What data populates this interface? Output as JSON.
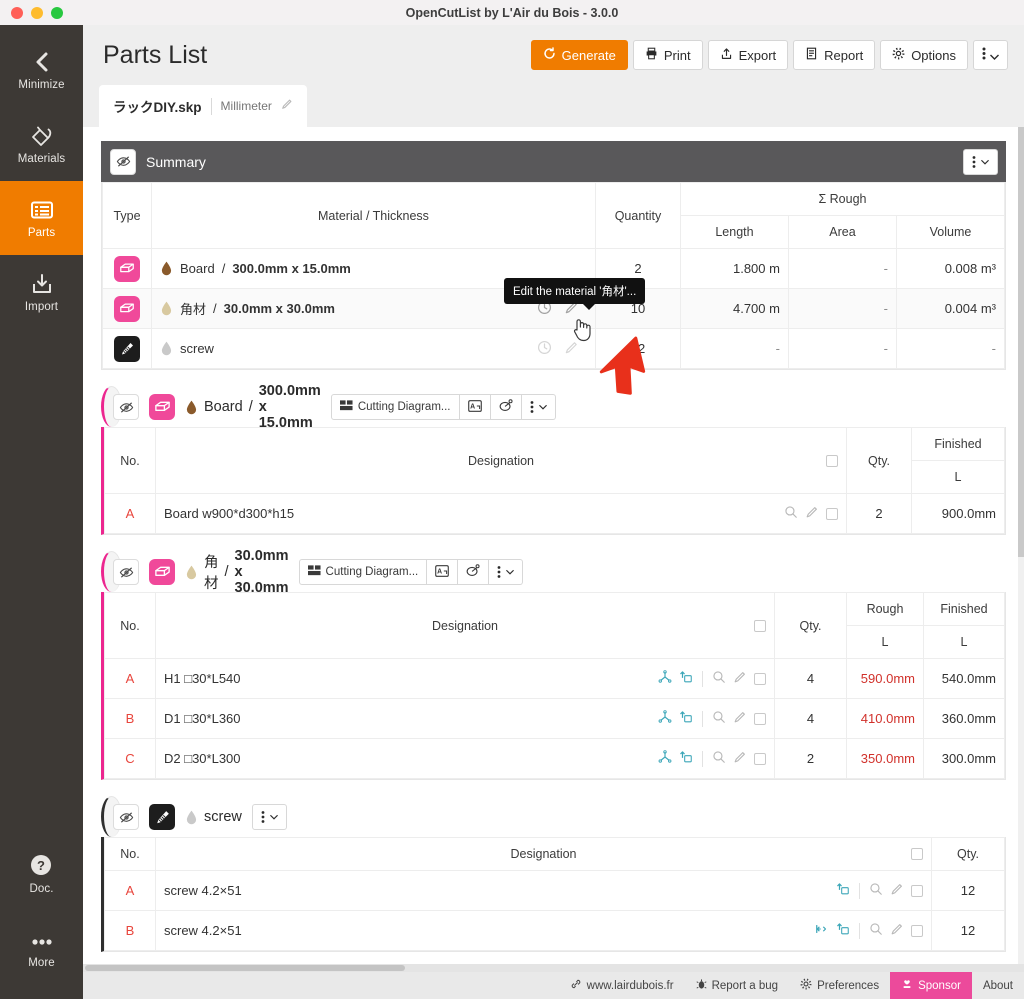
{
  "window": {
    "title": "OpenCutList by L'Air du Bois - 3.0.0"
  },
  "sidebar": {
    "items": [
      {
        "label": "Minimize",
        "icon": "chevron-left-icon",
        "active": false
      },
      {
        "label": "Materials",
        "icon": "materials-paint-icon",
        "active": false
      },
      {
        "label": "Parts",
        "icon": "parts-list-icon",
        "active": true
      },
      {
        "label": "Import",
        "icon": "import-download-icon",
        "active": false
      }
    ],
    "bottom": [
      {
        "label": "Doc.",
        "icon": "question-circle-icon"
      },
      {
        "label": "More",
        "icon": "ellipsis-icon"
      }
    ]
  },
  "header": {
    "title": "Parts List",
    "buttons": [
      {
        "label": "Generate",
        "icon": "refresh-icon",
        "primary": true
      },
      {
        "label": "Print",
        "icon": "printer-icon",
        "primary": false
      },
      {
        "label": "Export",
        "icon": "export-upload-icon",
        "primary": false
      },
      {
        "label": "Report",
        "icon": "report-icon",
        "primary": false
      },
      {
        "label": "Options",
        "icon": "gear-icon",
        "primary": false
      }
    ],
    "kebab_label": "⋮"
  },
  "tab": {
    "name": "ラックDIY.skp",
    "unit": "Millimeter",
    "edit_icon": "pencil-icon"
  },
  "tooltip": {
    "text": "Edit the material '角材'..."
  },
  "summary": {
    "title": "Summary",
    "headers": {
      "type": "Type",
      "material": "Material / Thickness",
      "quantity": "Quantity",
      "group": "Σ Rough",
      "length": "Length",
      "area": "Area",
      "volume": "Volume"
    },
    "rows": [
      {
        "type_icon": "board-solid-icon",
        "name": "Board",
        "spec": "300.0mm x 15.0mm",
        "quantity": "2",
        "length": "1.800 m",
        "area": "-",
        "volume": "0.008 m³",
        "dot": "#8a5a2b"
      },
      {
        "type_icon": "board-solid-icon",
        "name": "角材",
        "spec": "30.0mm x 30.0mm",
        "quantity": "10",
        "length": "4.700 m",
        "area": "-",
        "volume": "0.004 m³",
        "dot": "#d8c9a0"
      },
      {
        "type_icon": "screw-icon",
        "name": "screw",
        "spec": "",
        "quantity": "32",
        "length": "-",
        "area": "-",
        "volume": "-",
        "dot": "#c9c9c9"
      }
    ]
  },
  "sections": [
    {
      "id": "board",
      "accent": "pink",
      "badge_icon": "board-solid-icon",
      "badge_style": "pink",
      "dot": "#8a5a2b",
      "name": "Board",
      "spec": "300.0mm x 15.0mm",
      "actions": [
        {
          "label": "Cutting Diagram...",
          "icon": "cutting-diagram-icon"
        },
        {
          "label": "",
          "icon": "labels-icon"
        },
        {
          "label": "",
          "icon": "layout-3d-icon"
        },
        {
          "label": "⋮",
          "icon": "kebab-icon"
        }
      ],
      "headers": {
        "no": "No.",
        "designation": "Designation",
        "qty": "Qty.",
        "rough": "",
        "finished": "Finished",
        "rough_sub": "",
        "finished_sub": "L"
      },
      "has_rough": false,
      "rows": [
        {
          "no": "A",
          "designation": "Board w900*d300*h15",
          "qty": "2",
          "rough": "",
          "finished": "900.0mm",
          "icons": []
        }
      ]
    },
    {
      "id": "kakuzai",
      "accent": "pink",
      "badge_icon": "board-solid-icon",
      "badge_style": "pink",
      "dot": "#d8c9a0",
      "name": "角材",
      "spec": "30.0mm x 30.0mm",
      "actions": [
        {
          "label": "Cutting Diagram...",
          "icon": "cutting-diagram-icon"
        },
        {
          "label": "",
          "icon": "labels-icon"
        },
        {
          "label": "",
          "icon": "layout-3d-icon"
        },
        {
          "label": "⋮",
          "icon": "kebab-icon"
        }
      ],
      "headers": {
        "no": "No.",
        "designation": "Designation",
        "qty": "Qty.",
        "rough": "Rough",
        "finished": "Finished",
        "rough_sub": "L",
        "finished_sub": "L"
      },
      "has_rough": true,
      "rows": [
        {
          "no": "A",
          "designation": "H1 □30*L540",
          "qty": "4",
          "rough": "590.0mm",
          "finished": "540.0mm",
          "icons": [
            "axes-icon",
            "orient-icon"
          ]
        },
        {
          "no": "B",
          "designation": "D1 □30*L360",
          "qty": "4",
          "rough": "410.0mm",
          "finished": "360.0mm",
          "icons": [
            "axes-icon",
            "orient-icon"
          ]
        },
        {
          "no": "C",
          "designation": "D2 □30*L300",
          "qty": "2",
          "rough": "350.0mm",
          "finished": "300.0mm",
          "icons": [
            "axes-icon",
            "orient-icon"
          ]
        }
      ]
    },
    {
      "id": "screw",
      "accent": "dark",
      "badge_icon": "screw-icon",
      "badge_style": "black",
      "dot": "#c9c9c9",
      "name": "screw",
      "spec": "",
      "actions": [
        {
          "label": "⋮",
          "icon": "kebab-icon"
        }
      ],
      "headers": {
        "no": "No.",
        "designation": "Designation",
        "qty": "Qty.",
        "rough": "",
        "finished": "",
        "rough_sub": "",
        "finished_sub": ""
      },
      "has_rough": false,
      "simple": true,
      "rows": [
        {
          "no": "A",
          "designation": "screw 4.2×51",
          "qty": "12",
          "rough": "",
          "finished": "",
          "icons": [
            "orient-icon"
          ]
        },
        {
          "no": "B",
          "designation": "screw 4.2×51",
          "qty": "12",
          "rough": "",
          "finished": "",
          "icons": [
            "flip-icon",
            "orient-icon"
          ]
        }
      ]
    }
  ],
  "footer": {
    "items": [
      {
        "label": "www.lairdubois.fr",
        "icon": "link-icon",
        "highlight": false
      },
      {
        "label": "Report a bug",
        "icon": "bug-icon",
        "highlight": false
      },
      {
        "label": "Preferences",
        "icon": "gear-icon",
        "highlight": false
      },
      {
        "label": "Sponsor",
        "icon": "sponsor-heart-icon",
        "highlight": true
      },
      {
        "label": "About",
        "icon": "",
        "highlight": false
      }
    ]
  },
  "colors": {
    "accent_orange": "#f07c00",
    "accent_pink": "#ec268f",
    "sponsor_pink": "#ec4a9b",
    "sidebar_bg": "#3d3935",
    "rough_red": "#d1312b",
    "rowno_red": "#e8453c"
  }
}
